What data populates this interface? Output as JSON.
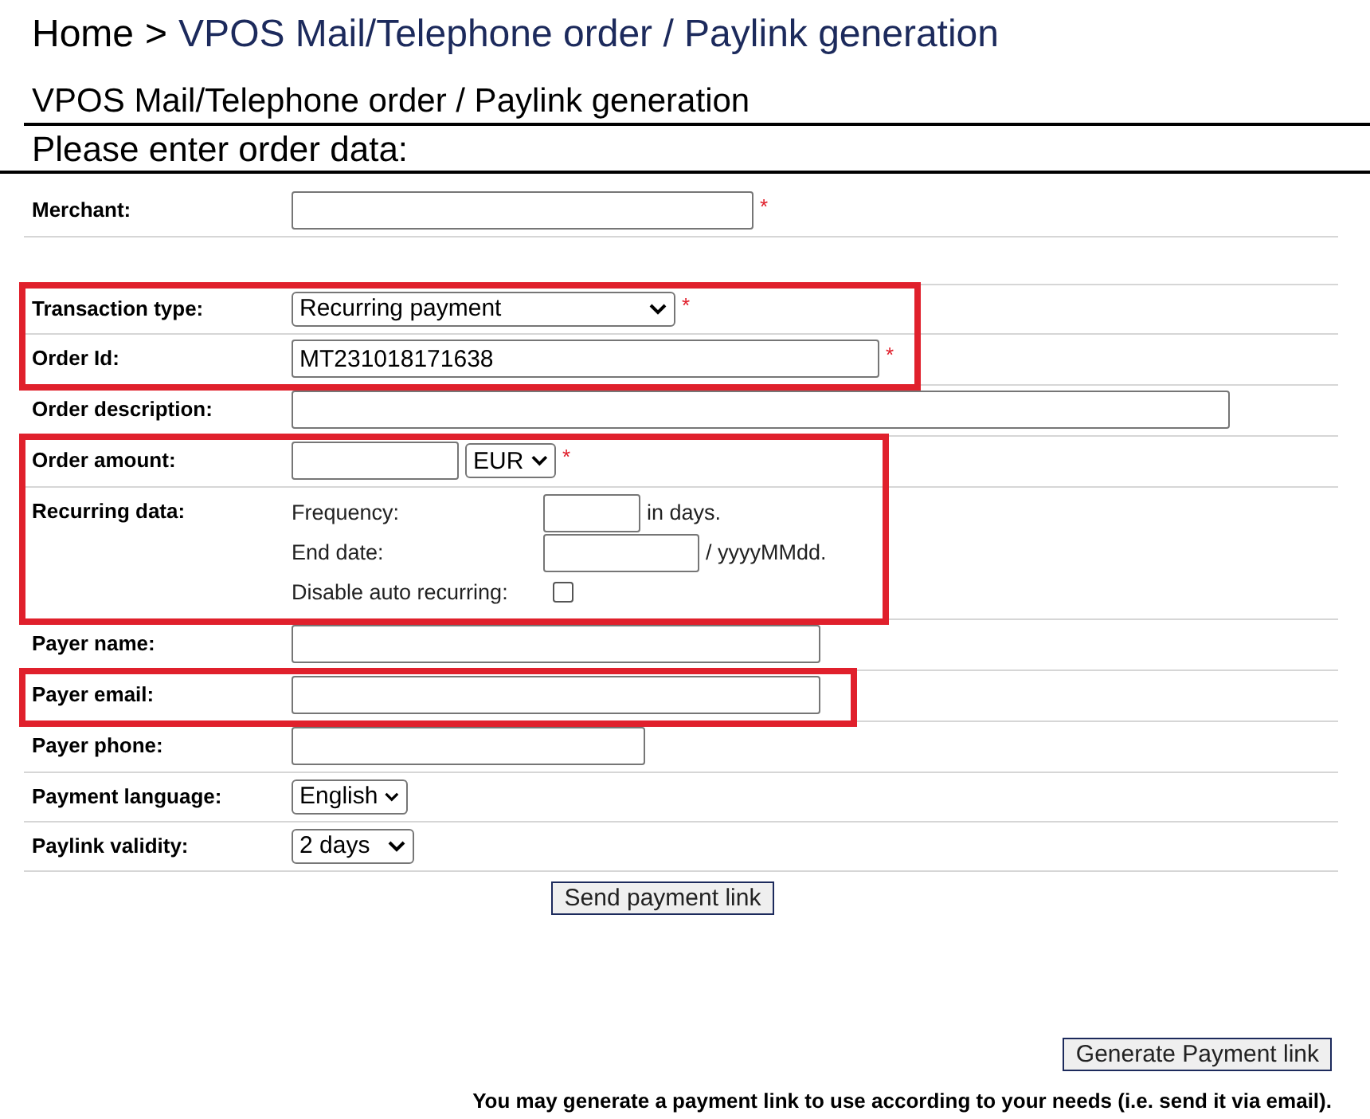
{
  "breadcrumb": {
    "home": "Home",
    "separator": ">",
    "current": "VPOS Mail/Telephone order / Paylink generation"
  },
  "page_title": "VPOS Mail/Telephone order / Paylink generation",
  "section_title": "Please enter order data:",
  "required_mark": "*",
  "rows": [
    {
      "kind": "text",
      "label": "Merchant:",
      "value": "",
      "required": true,
      "highlighted": false
    },
    {
      "kind": "blank",
      "highlighted": false
    },
    {
      "kind": "select",
      "label": "Transaction type:",
      "value": "Recurring payment",
      "required": true,
      "highlighted": true
    },
    {
      "kind": "text",
      "label": "Order Id:",
      "value": "MT231018171638",
      "required": true,
      "highlighted": true
    },
    {
      "kind": "text",
      "label": "Order description:",
      "value": "",
      "required": false,
      "highlighted": false
    },
    {
      "kind": "amount",
      "label": "Order amount:",
      "value": "",
      "currency": "EUR",
      "required": true,
      "highlighted": true
    },
    {
      "kind": "recurring",
      "label": "Recurring data:",
      "highlighted": true,
      "items": [
        {
          "kind": "text",
          "label": "Frequency:",
          "value": "",
          "suffix": "in days."
        },
        {
          "kind": "text",
          "label": "End date:",
          "value": "",
          "suffix": "/ yyyyMMdd."
        },
        {
          "kind": "checkbox",
          "label": "Disable auto recurring:",
          "checked": false
        }
      ]
    },
    {
      "kind": "text",
      "label": "Payer name:",
      "value": "",
      "required": false,
      "highlighted": false
    },
    {
      "kind": "text",
      "label": "Payer email:",
      "value": "",
      "required": false,
      "highlighted": true
    },
    {
      "kind": "text",
      "label": "Payer phone:",
      "value": "",
      "required": false,
      "highlighted": false
    },
    {
      "kind": "select",
      "label": "Payment language:",
      "value": "English",
      "required": false,
      "highlighted": false
    },
    {
      "kind": "select",
      "label": "Paylink validity:",
      "value": "2 days",
      "required": false,
      "highlighted": false
    }
  ],
  "send_button": "Send payment link",
  "generate_button": "Generate Payment link",
  "footnote": "You may generate a payment link to use according to your needs (i.e. send it via email)."
}
